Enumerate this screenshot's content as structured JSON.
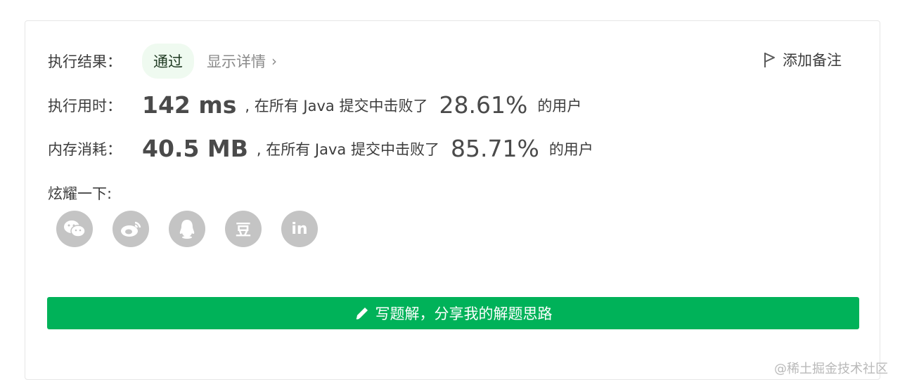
{
  "result": {
    "label": "执行结果：",
    "status": "通过",
    "detail": "显示详情",
    "chevron": "›"
  },
  "add_note": {
    "label": "添加备注",
    "icon": "flag-icon"
  },
  "runtime": {
    "label": "执行用时：",
    "value": "142 ms",
    "prefix": ", 在所有 Java 提交中击败了",
    "percent": "28.61%",
    "suffix": "的用户"
  },
  "memory": {
    "label": "内存消耗：",
    "value": "40.5 MB",
    "prefix": ", 在所有 Java 提交中击败了",
    "percent": "85.71%",
    "suffix": "的用户"
  },
  "share": {
    "label": "炫耀一下:",
    "items": [
      {
        "name": "wechat-icon"
      },
      {
        "name": "weibo-icon"
      },
      {
        "name": "qq-icon"
      },
      {
        "name": "douban-icon",
        "text": "豆"
      },
      {
        "name": "linkedin-icon",
        "text": "in"
      }
    ]
  },
  "write_solution": {
    "label": "写题解，分享我的解题思路",
    "icon": "pencil-icon"
  },
  "watermark": "@稀土掘金技术社区",
  "colors": {
    "accent_green": "#00b259",
    "status_bg": "#effaf0",
    "share_icon_bg": "#c4c4c4",
    "muted_text": "#8a8a8a"
  }
}
